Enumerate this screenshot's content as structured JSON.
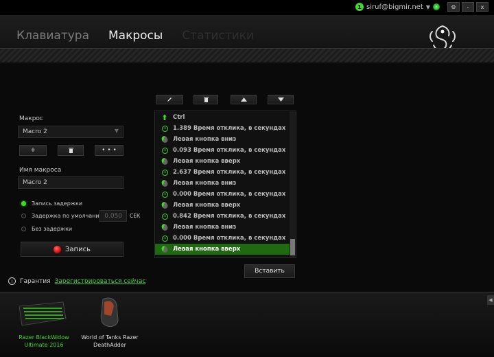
{
  "account": {
    "badge": "1",
    "email": "siruf@bigmir.net"
  },
  "window_controls": {
    "settings": "⚙",
    "minimize": "-",
    "close": "x"
  },
  "tabs": [
    {
      "label": "Клавиатура"
    },
    {
      "label": "Макросы"
    },
    {
      "label": "Статистики"
    }
  ],
  "left_panel": {
    "macro_label": "Макрос",
    "macro_selected": "Macro 2",
    "add_label": "+",
    "more_label": "• • •",
    "name_label": "Имя макроса",
    "name_value": "Macro 2",
    "radios": [
      {
        "label": "Запись задержки",
        "selected": true
      },
      {
        "label": "Задержка по умолчанию",
        "selected": false
      },
      {
        "label": "Без задержки",
        "selected": false
      }
    ],
    "delay_value": "0.050",
    "delay_unit": "СЕК",
    "record_label": "Запись"
  },
  "macro_list": {
    "rows": [
      {
        "icon": "up-arrow-icon",
        "text": "Ctrl",
        "selected": false
      },
      {
        "icon": "clock-icon",
        "text": "1.389 Время отклика, в секундах",
        "selected": false
      },
      {
        "icon": "mouse-icon",
        "text": "Левая кнопка вниз",
        "selected": false
      },
      {
        "icon": "clock-icon",
        "text": "0.093 Время отклика, в секундах",
        "selected": false
      },
      {
        "icon": "mouse-icon",
        "text": "Левая кнопка вверх",
        "selected": false
      },
      {
        "icon": "clock-icon",
        "text": "2.637 Время отклика, в секундах",
        "selected": false
      },
      {
        "icon": "mouse-icon",
        "text": "Левая кнопка вниз",
        "selected": false
      },
      {
        "icon": "clock-icon",
        "text": "0.000 Время отклика, в секундах",
        "selected": false
      },
      {
        "icon": "mouse-icon",
        "text": "Левая кнопка вверх",
        "selected": false
      },
      {
        "icon": "clock-icon",
        "text": "0.842 Время отклика, в секундах",
        "selected": false
      },
      {
        "icon": "mouse-icon",
        "text": "Левая кнопка вниз",
        "selected": false
      },
      {
        "icon": "clock-icon",
        "text": "0.000 Время отклика, в секундах",
        "selected": false
      },
      {
        "icon": "mouse-icon",
        "text": "Левая кнопка вверх",
        "selected": true
      }
    ],
    "insert_label": "Вставить"
  },
  "warranty": {
    "label": "Гарантия",
    "link": "Зарегистрироваться сейчас"
  },
  "devices": [
    {
      "name_line1": "Razer BlackWidow",
      "name_line2": "Ultimate 2016",
      "active": true
    },
    {
      "name_line1": "World of Tanks Razer",
      "name_line2": "DeathAdder",
      "active": false
    }
  ],
  "colors": {
    "accent": "#44d62c",
    "selected_row": "#1f6a10",
    "record": "#cc0000"
  }
}
